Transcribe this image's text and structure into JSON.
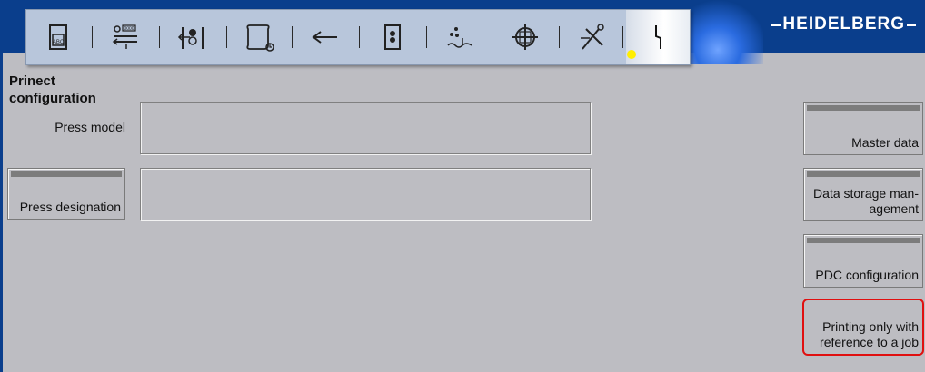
{
  "brand": "HEIDELBERG",
  "toolbar": {
    "icons": [
      {
        "name": "job-card-icon",
        "label": "ABC"
      },
      {
        "name": "feeder-icon",
        "label": "0000"
      },
      {
        "name": "ink-unit-icon"
      },
      {
        "name": "scroll-clock-icon"
      },
      {
        "name": "arrow-left-icon"
      },
      {
        "name": "door-icon"
      },
      {
        "name": "dampening-icon"
      },
      {
        "name": "register-crosshair-icon"
      },
      {
        "name": "tools-icon"
      },
      {
        "name": "service-lightning-icon"
      }
    ],
    "active_index": 9,
    "indicator_color": "#ffee00"
  },
  "page": {
    "title_line1": "Prinect",
    "title_line2": "configuration"
  },
  "form": {
    "press_model_label": "Press model",
    "press_model_value": "",
    "press_designation_label": "Press designation",
    "press_designation_value": ""
  },
  "side_buttons": {
    "master_data": "Master data",
    "data_storage_line1": "Data storage man-",
    "data_storage_line2": "agement",
    "pdc_configuration": "PDC configuration",
    "printing_only_line1": "Printing only with",
    "printing_only_line2": "reference to a job"
  },
  "colors": {
    "header": "#0a3e8c",
    "background": "#bdbdc2",
    "highlight": "#e01010"
  }
}
